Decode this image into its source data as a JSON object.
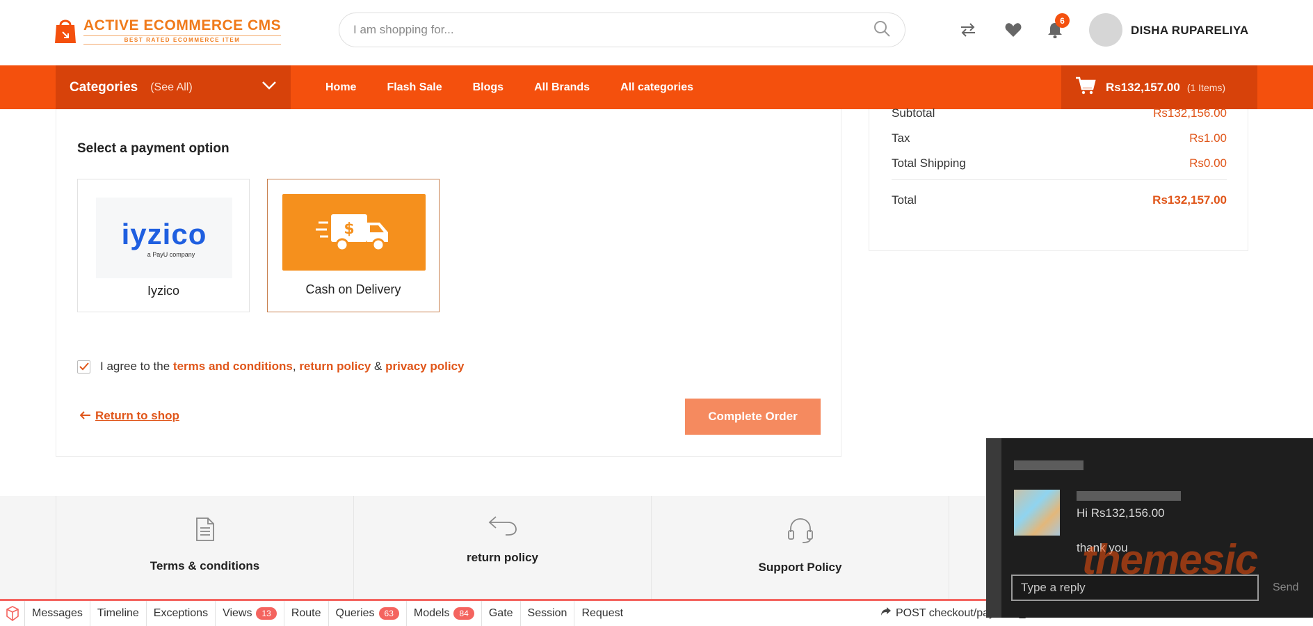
{
  "header": {
    "logo_title": "ACTIVE ECOMMERCE CMS",
    "logo_subtitle": "BEST RATED ECOMMERCE ITEM",
    "search_placeholder": "I am shopping for...",
    "notification_count": "6",
    "user_name": "DISHA RUPARELIYA"
  },
  "nav": {
    "categories_label": "Categories",
    "see_all_label": "(See All)",
    "links": [
      "Home",
      "Flash Sale",
      "Blogs",
      "All Brands",
      "All categories"
    ],
    "cart_amount": "Rs132,157.00",
    "cart_items": "(1 Items)"
  },
  "payment": {
    "heading": "Select a payment option",
    "options": [
      {
        "label": "Iyzico",
        "logo_text": "iyzico",
        "logo_sub": "a PayU company",
        "selected": false
      },
      {
        "label": "Cash on Delivery",
        "selected": true
      }
    ],
    "agree_prefix": "I agree to the",
    "terms_link": "terms and conditions",
    "sep1": ",",
    "return_link": "return policy",
    "sep2": "&",
    "privacy_link": "privacy policy",
    "return_to_shop": "Return to shop",
    "complete_button": "Complete Order"
  },
  "summary": {
    "rows": [
      {
        "label": "Subtotal",
        "value": "Rs132,156.00"
      },
      {
        "label": "Tax",
        "value": "Rs1.00"
      },
      {
        "label": "Total Shipping",
        "value": "Rs0.00"
      }
    ],
    "total_label": "Total",
    "total_value": "Rs132,157.00"
  },
  "policies": [
    "Terms & conditions",
    "return policy",
    "Support Policy"
  ],
  "debugbar": {
    "items": [
      {
        "label": "Messages"
      },
      {
        "label": "Timeline"
      },
      {
        "label": "Exceptions"
      },
      {
        "label": "Views",
        "count": "13"
      },
      {
        "label": "Route"
      },
      {
        "label": "Queries",
        "count": "63"
      },
      {
        "label": "Models",
        "count": "84"
      },
      {
        "label": "Gate"
      },
      {
        "label": "Session"
      },
      {
        "label": "Request"
      }
    ],
    "route_text": "POST checkout/payment_select"
  },
  "chat": {
    "message_1": "Hi Rs132,156.00",
    "message_2": "thank you",
    "reply_placeholder": "Type a reply",
    "send_label": "Send"
  },
  "watermark": "themesic",
  "colors": {
    "brand_orange": "#f4500d",
    "nav_dark": "#d7420a",
    "link_orange": "#e0561a",
    "button_orange": "#f58a5f",
    "cod_orange": "#f5901d",
    "iyzico_blue": "#1f5fe0"
  }
}
